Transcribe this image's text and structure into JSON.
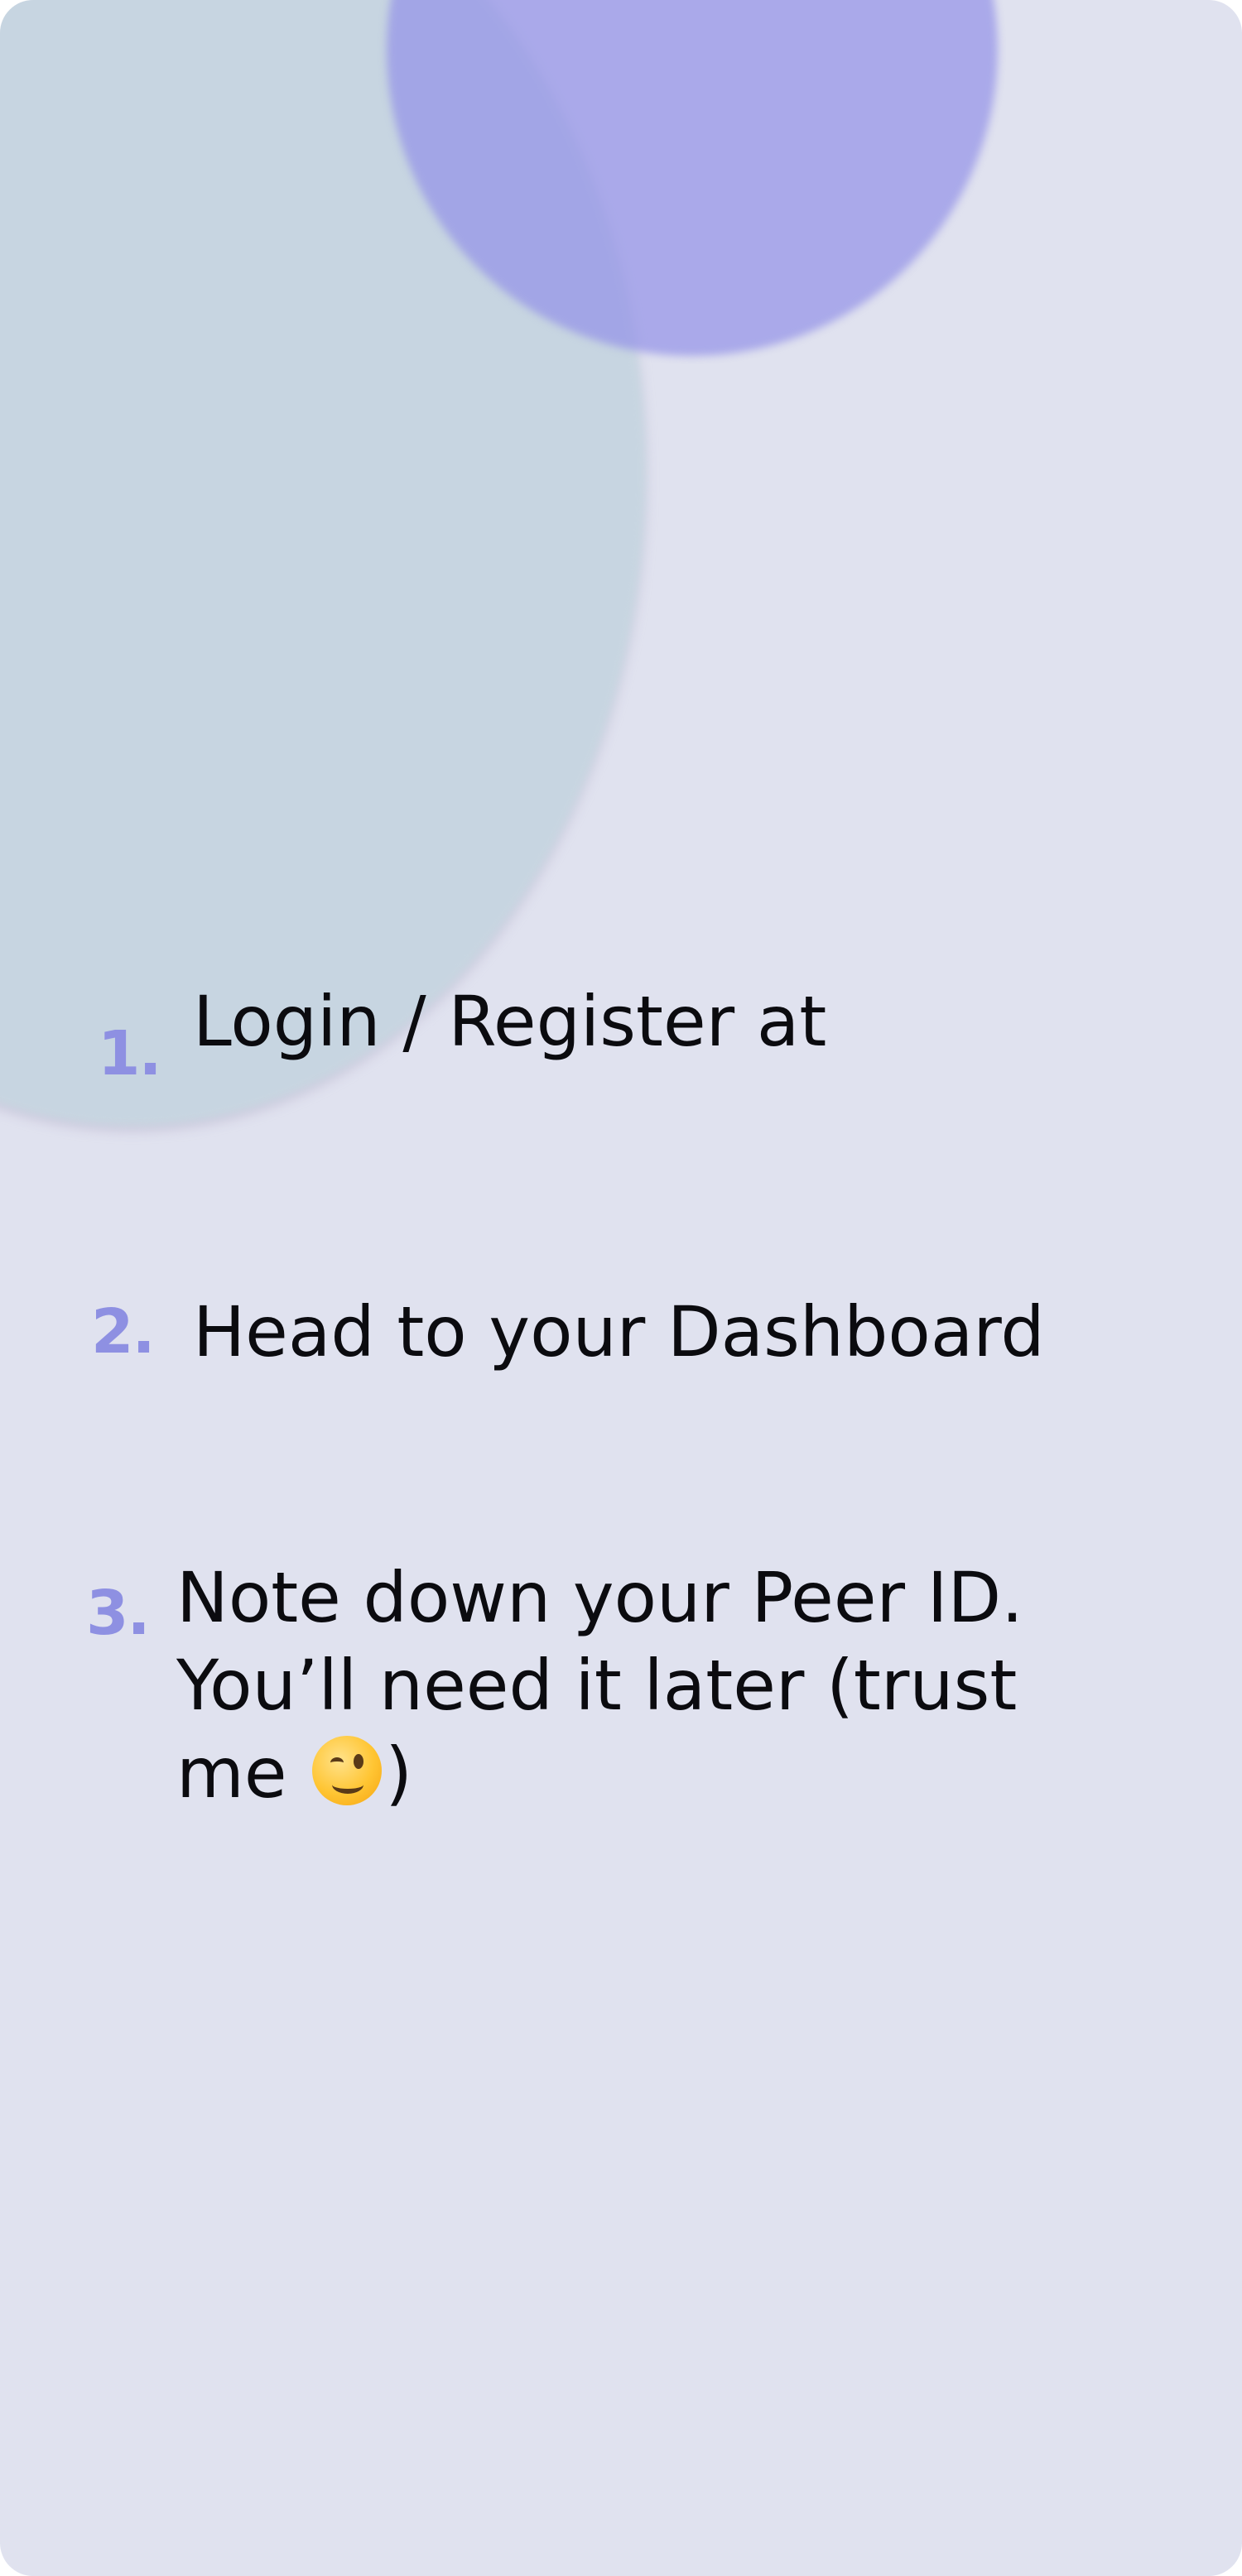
{
  "steps": [
    {
      "number": "1.",
      "text": "Login / Register at"
    },
    {
      "number": "2.",
      "text": "Head to your Dashboard"
    },
    {
      "number": "3.",
      "line1": "Note down your Peer ID.",
      "line2": "You’ll need it later (trust",
      "line3_before": "me ",
      "line3_after": ")",
      "emoji": "winking-face-emoji"
    }
  ],
  "colors": {
    "background": "#e0e2ef",
    "step_number": "#8e90e2",
    "text": "#0b0b0f",
    "blob_teal": "#c6d5e0",
    "blob_violet": "#9493e8"
  }
}
